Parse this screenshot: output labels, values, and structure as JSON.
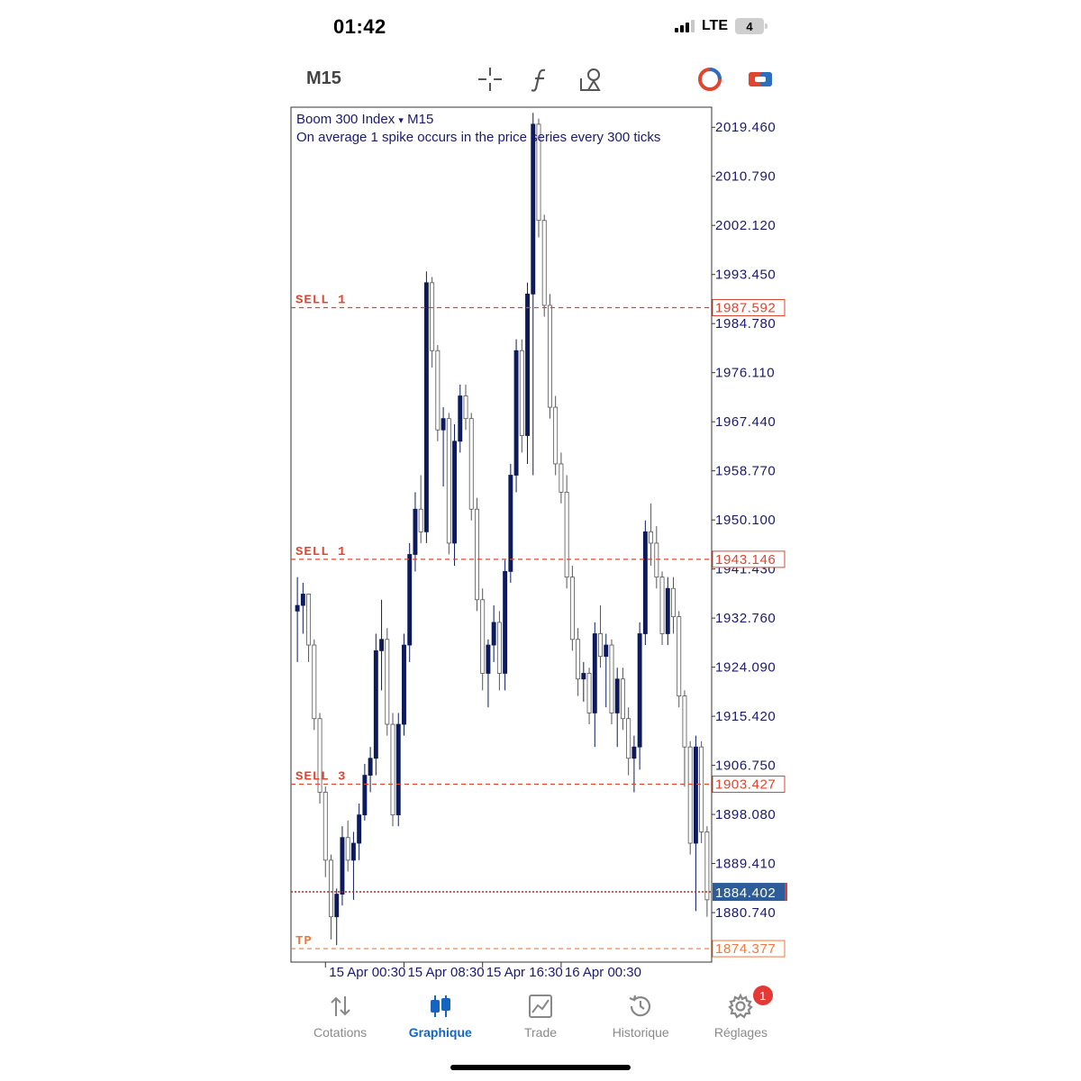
{
  "status": {
    "time": "01:42",
    "network": "LTE",
    "battery": "4"
  },
  "toolbar": {
    "timeframe": "M15",
    "icons": [
      "crosshair-icon",
      "indicator-f-icon",
      "objects-icon",
      "one-click-trading-icon",
      "trade-panel-icon"
    ]
  },
  "chart": {
    "symbol": "Boom 300 Index",
    "dropdown_glyph": "▾",
    "timeframe": "M15",
    "description": "On average 1 spike occurs in the price series every 300 ticks"
  },
  "chart_data": {
    "type": "candlestick",
    "title": "Boom 300 Index ▾ M15",
    "subtitle": "On average 1 spike occurs in the price series every 300 ticks",
    "y_ticks": [
      "2019.460",
      "2010.790",
      "2002.120",
      "1993.450",
      "1984.780",
      "1976.110",
      "1967.440",
      "1958.770",
      "1950.100",
      "1941.430",
      "1932.760",
      "1924.090",
      "1915.420",
      "1906.750",
      "1898.080",
      "1889.410",
      "1880.740"
    ],
    "ylim": [
      1872,
      2023
    ],
    "x_ticks": [
      "15 Apr 00:30",
      "15 Apr 08:30",
      "15 Apr 16:30",
      "16 Apr 00:30"
    ],
    "current_price": "1884.402",
    "levels": [
      {
        "label": "SELL 1",
        "price": "1987.592",
        "color": "#e0452f"
      },
      {
        "label": "SELL 1",
        "price": "1943.146",
        "color": "#e0452f"
      },
      {
        "label": "SELL 3",
        "price": "1903.427",
        "color": "#e0452f"
      },
      {
        "label": "TP",
        "price": "1874.377",
        "color": "#f07a3c"
      }
    ],
    "candles": [
      {
        "o": 1934,
        "h": 1940,
        "l": 1925,
        "c": 1935
      },
      {
        "o": 1935,
        "h": 1939,
        "l": 1930,
        "c": 1937
      },
      {
        "o": 1937,
        "h": 1937,
        "l": 1925,
        "c": 1928
      },
      {
        "o": 1928,
        "h": 1929,
        "l": 1913,
        "c": 1915
      },
      {
        "o": 1915,
        "h": 1916,
        "l": 1900,
        "c": 1902
      },
      {
        "o": 1902,
        "h": 1903,
        "l": 1887,
        "c": 1890
      },
      {
        "o": 1890,
        "h": 1891,
        "l": 1876,
        "c": 1880
      },
      {
        "o": 1880,
        "h": 1885,
        "l": 1875,
        "c": 1884
      },
      {
        "o": 1884,
        "h": 1896,
        "l": 1882,
        "c": 1894
      },
      {
        "o": 1894,
        "h": 1897,
        "l": 1888,
        "c": 1890
      },
      {
        "o": 1890,
        "h": 1895,
        "l": 1883,
        "c": 1893
      },
      {
        "o": 1893,
        "h": 1900,
        "l": 1890,
        "c": 1898
      },
      {
        "o": 1898,
        "h": 1907,
        "l": 1897,
        "c": 1905
      },
      {
        "o": 1905,
        "h": 1910,
        "l": 1902,
        "c": 1908
      },
      {
        "o": 1908,
        "h": 1930,
        "l": 1905,
        "c": 1927
      },
      {
        "o": 1927,
        "h": 1936,
        "l": 1920,
        "c": 1929
      },
      {
        "o": 1929,
        "h": 1931,
        "l": 1912,
        "c": 1914
      },
      {
        "o": 1914,
        "h": 1916,
        "l": 1896,
        "c": 1898
      },
      {
        "o": 1898,
        "h": 1916,
        "l": 1896,
        "c": 1914
      },
      {
        "o": 1914,
        "h": 1930,
        "l": 1912,
        "c": 1928
      },
      {
        "o": 1928,
        "h": 1946,
        "l": 1925,
        "c": 1944
      },
      {
        "o": 1944,
        "h": 1955,
        "l": 1941,
        "c": 1952
      },
      {
        "o": 1952,
        "h": 1958,
        "l": 1946,
        "c": 1948
      },
      {
        "o": 1948,
        "h": 1994,
        "l": 1946,
        "c": 1992
      },
      {
        "o": 1992,
        "h": 1993,
        "l": 1977,
        "c": 1980
      },
      {
        "o": 1980,
        "h": 1981,
        "l": 1964,
        "c": 1966
      },
      {
        "o": 1966,
        "h": 1970,
        "l": 1956,
        "c": 1968
      },
      {
        "o": 1968,
        "h": 1969,
        "l": 1944,
        "c": 1946
      },
      {
        "o": 1946,
        "h": 1967,
        "l": 1942,
        "c": 1964
      },
      {
        "o": 1964,
        "h": 1974,
        "l": 1962,
        "c": 1972
      },
      {
        "o": 1972,
        "h": 1974,
        "l": 1966,
        "c": 1968
      },
      {
        "o": 1968,
        "h": 1969,
        "l": 1950,
        "c": 1952
      },
      {
        "o": 1952,
        "h": 1954,
        "l": 1934,
        "c": 1936
      },
      {
        "o": 1936,
        "h": 1938,
        "l": 1920,
        "c": 1923
      },
      {
        "o": 1923,
        "h": 1929,
        "l": 1917,
        "c": 1928
      },
      {
        "o": 1928,
        "h": 1935,
        "l": 1925,
        "c": 1932
      },
      {
        "o": 1932,
        "h": 1934,
        "l": 1920,
        "c": 1923
      },
      {
        "o": 1923,
        "h": 1943,
        "l": 1920,
        "c": 1941
      },
      {
        "o": 1941,
        "h": 1960,
        "l": 1939,
        "c": 1958
      },
      {
        "o": 1958,
        "h": 1982,
        "l": 1955,
        "c": 1980
      },
      {
        "o": 1980,
        "h": 1982,
        "l": 1962,
        "c": 1965
      },
      {
        "o": 1965,
        "h": 1992,
        "l": 1960,
        "c": 1990
      },
      {
        "o": 1990,
        "h": 2022,
        "l": 1958,
        "c": 2020
      },
      {
        "o": 2020,
        "h": 2021,
        "l": 2000,
        "c": 2003
      },
      {
        "o": 2003,
        "h": 2004,
        "l": 1986,
        "c": 1988
      },
      {
        "o": 1988,
        "h": 1990,
        "l": 1968,
        "c": 1970
      },
      {
        "o": 1970,
        "h": 1972,
        "l": 1958,
        "c": 1960
      },
      {
        "o": 1960,
        "h": 1962,
        "l": 1953,
        "c": 1955
      },
      {
        "o": 1955,
        "h": 1958,
        "l": 1938,
        "c": 1940
      },
      {
        "o": 1940,
        "h": 1942,
        "l": 1927,
        "c": 1929
      },
      {
        "o": 1929,
        "h": 1931,
        "l": 1919,
        "c": 1922
      },
      {
        "o": 1922,
        "h": 1925,
        "l": 1918,
        "c": 1923
      },
      {
        "o": 1923,
        "h": 1924,
        "l": 1914,
        "c": 1916
      },
      {
        "o": 1916,
        "h": 1932,
        "l": 1910,
        "c": 1930
      },
      {
        "o": 1930,
        "h": 1935,
        "l": 1924,
        "c": 1926
      },
      {
        "o": 1926,
        "h": 1930,
        "l": 1917,
        "c": 1928
      },
      {
        "o": 1928,
        "h": 1929,
        "l": 1914,
        "c": 1916
      },
      {
        "o": 1916,
        "h": 1924,
        "l": 1910,
        "c": 1922
      },
      {
        "o": 1922,
        "h": 1924,
        "l": 1913,
        "c": 1915
      },
      {
        "o": 1915,
        "h": 1917,
        "l": 1905,
        "c": 1908
      },
      {
        "o": 1908,
        "h": 1912,
        "l": 1902,
        "c": 1910
      },
      {
        "o": 1910,
        "h": 1932,
        "l": 1906,
        "c": 1930
      },
      {
        "o": 1930,
        "h": 1950,
        "l": 1928,
        "c": 1948
      },
      {
        "o": 1948,
        "h": 1953,
        "l": 1942,
        "c": 1946
      },
      {
        "o": 1946,
        "h": 1949,
        "l": 1938,
        "c": 1940
      },
      {
        "o": 1940,
        "h": 1941,
        "l": 1928,
        "c": 1930
      },
      {
        "o": 1930,
        "h": 1940,
        "l": 1928,
        "c": 1938
      },
      {
        "o": 1938,
        "h": 1940,
        "l": 1930,
        "c": 1933
      },
      {
        "o": 1933,
        "h": 1934,
        "l": 1917,
        "c": 1919
      },
      {
        "o": 1919,
        "h": 1920,
        "l": 1903,
        "c": 1910
      },
      {
        "o": 1910,
        "h": 1911,
        "l": 1891,
        "c": 1893
      },
      {
        "o": 1893,
        "h": 1912,
        "l": 1881,
        "c": 1910
      },
      {
        "o": 1910,
        "h": 1911,
        "l": 1893,
        "c": 1895
      },
      {
        "o": 1895,
        "h": 1896,
        "l": 1880,
        "c": 1883
      }
    ]
  },
  "nav": {
    "items": [
      {
        "label": "Cotations",
        "icon": "quotes-arrows-icon"
      },
      {
        "label": "Graphique",
        "icon": "candlestick-chart-icon"
      },
      {
        "label": "Trade",
        "icon": "trade-chart-icon"
      },
      {
        "label": "Historique",
        "icon": "history-clock-icon"
      },
      {
        "label": "Réglages",
        "icon": "settings-gear-icon"
      }
    ],
    "active": "Graphique",
    "settings_badge": "1"
  },
  "colors": {
    "bull_candle": "#0d1b5c",
    "bear_candle": "#ffffff",
    "level_line": "#e0452f",
    "tp_line": "#f07a3c",
    "current_price_bg": "#2c5d9a",
    "active_nav": "#1565c0"
  }
}
